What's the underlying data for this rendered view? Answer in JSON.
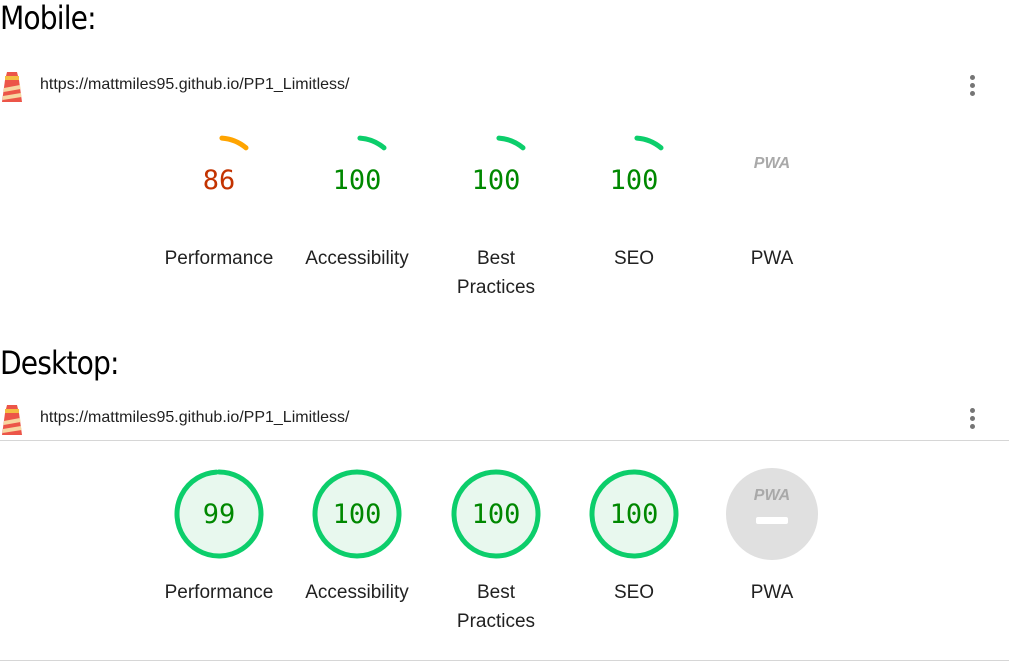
{
  "colors": {
    "pass": "#0cce6b",
    "pass_fill": "#e8f8ee",
    "pass_text": "#008800",
    "average": "#ffa400",
    "average_text": "#c33300",
    "na_fill": "#e0e0e0",
    "na_mark": "#a9a9a9"
  },
  "mobile": {
    "heading": "Mobile:",
    "url": "https://mattmiles95.github.io/PP1_Limitless/",
    "gauges": [
      {
        "value": "86",
        "label": "Performance",
        "status": "average",
        "score": 0.86
      },
      {
        "value": "100",
        "label": "Accessibility",
        "status": "pass",
        "score": 1.0
      },
      {
        "value": "100",
        "label": "Best Practices",
        "status": "pass",
        "score": 1.0
      },
      {
        "value": "100",
        "label": "SEO",
        "status": "pass",
        "score": 1.0
      },
      {
        "value": "",
        "label": "PWA",
        "status": "na",
        "badge": "PWA"
      }
    ]
  },
  "desktop": {
    "heading": "Desktop:",
    "url": "https://mattmiles95.github.io/PP1_Limitless/",
    "gauges": [
      {
        "value": "99",
        "label": "Performance",
        "status": "pass",
        "score": 0.99
      },
      {
        "value": "100",
        "label": "Accessibility",
        "status": "pass",
        "score": 1.0
      },
      {
        "value": "100",
        "label": "Best Practices",
        "status": "pass",
        "score": 1.0
      },
      {
        "value": "100",
        "label": "SEO",
        "status": "pass",
        "score": 1.0
      },
      {
        "value": "",
        "label": "PWA",
        "status": "na",
        "badge": "PWA"
      }
    ]
  }
}
